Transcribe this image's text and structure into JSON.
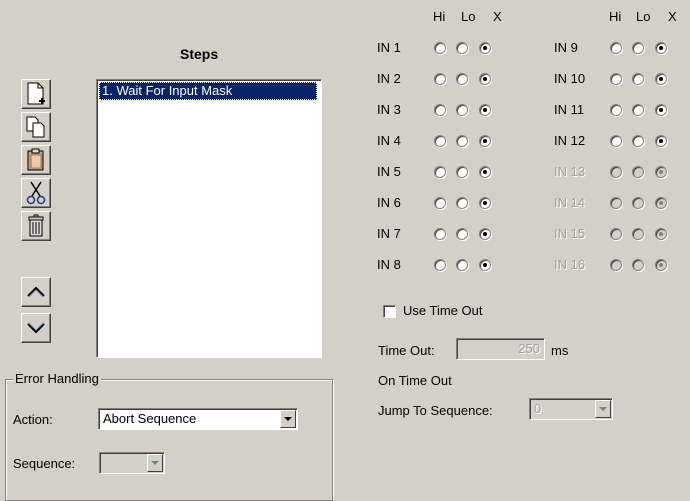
{
  "steps": {
    "title": "Steps",
    "items": [
      "1. Wait For Input Mask"
    ]
  },
  "toolbar": {
    "buttons": [
      "new-step-icon",
      "copy-icon",
      "paste-icon",
      "cut-icon",
      "delete-icon",
      "move-up-icon",
      "move-down-icon"
    ]
  },
  "inputs": {
    "header": {
      "hi": "Hi",
      "lo": "Lo",
      "x": "X"
    },
    "left": [
      {
        "label": "IN 1",
        "selected": "X"
      },
      {
        "label": "IN 2",
        "selected": "X"
      },
      {
        "label": "IN 3",
        "selected": "X"
      },
      {
        "label": "IN 4",
        "selected": "X"
      },
      {
        "label": "IN 5",
        "selected": "X"
      },
      {
        "label": "IN 6",
        "selected": "X"
      },
      {
        "label": "IN 7",
        "selected": "X"
      },
      {
        "label": "IN 8",
        "selected": "X"
      }
    ],
    "right": [
      {
        "label": "IN 9",
        "selected": "X",
        "enabled": true
      },
      {
        "label": "IN 10",
        "selected": "X",
        "enabled": true
      },
      {
        "label": "IN 11",
        "selected": "X",
        "enabled": true
      },
      {
        "label": "IN 12",
        "selected": "X",
        "enabled": true
      },
      {
        "label": "IN 13",
        "selected": "X",
        "enabled": false
      },
      {
        "label": "IN 14",
        "selected": "X",
        "enabled": false
      },
      {
        "label": "IN 15",
        "selected": "X",
        "enabled": false
      },
      {
        "label": "IN 16",
        "selected": "X",
        "enabled": false
      }
    ]
  },
  "timeout": {
    "use_label": "Use Time Out",
    "use_checked": false,
    "time_label": "Time Out:",
    "time_value": "250",
    "unit": "ms",
    "on_timeout_label": "On Time Out",
    "jump_label": "Jump To Sequence:",
    "jump_value": "0"
  },
  "error_handling": {
    "title": "Error Handling",
    "action_label": "Action:",
    "action_value": "Abort Sequence",
    "sequence_label": "Sequence:",
    "sequence_value": ""
  }
}
